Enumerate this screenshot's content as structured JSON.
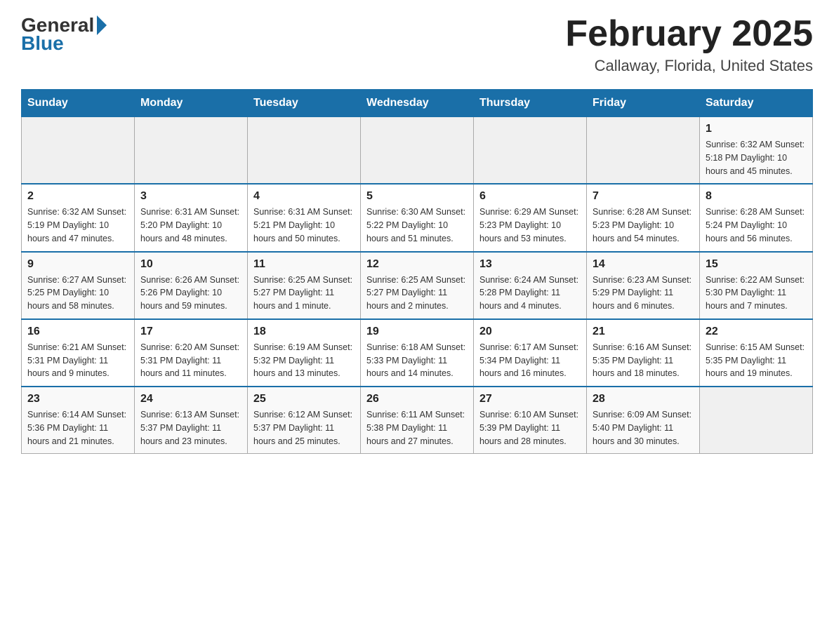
{
  "header": {
    "logo_general": "General",
    "logo_blue": "Blue",
    "title": "February 2025",
    "location": "Callaway, Florida, United States"
  },
  "weekdays": [
    "Sunday",
    "Monday",
    "Tuesday",
    "Wednesday",
    "Thursday",
    "Friday",
    "Saturday"
  ],
  "weeks": [
    [
      {
        "day": "",
        "info": ""
      },
      {
        "day": "",
        "info": ""
      },
      {
        "day": "",
        "info": ""
      },
      {
        "day": "",
        "info": ""
      },
      {
        "day": "",
        "info": ""
      },
      {
        "day": "",
        "info": ""
      },
      {
        "day": "1",
        "info": "Sunrise: 6:32 AM\nSunset: 5:18 PM\nDaylight: 10 hours\nand 45 minutes."
      }
    ],
    [
      {
        "day": "2",
        "info": "Sunrise: 6:32 AM\nSunset: 5:19 PM\nDaylight: 10 hours\nand 47 minutes."
      },
      {
        "day": "3",
        "info": "Sunrise: 6:31 AM\nSunset: 5:20 PM\nDaylight: 10 hours\nand 48 minutes."
      },
      {
        "day": "4",
        "info": "Sunrise: 6:31 AM\nSunset: 5:21 PM\nDaylight: 10 hours\nand 50 minutes."
      },
      {
        "day": "5",
        "info": "Sunrise: 6:30 AM\nSunset: 5:22 PM\nDaylight: 10 hours\nand 51 minutes."
      },
      {
        "day": "6",
        "info": "Sunrise: 6:29 AM\nSunset: 5:23 PM\nDaylight: 10 hours\nand 53 minutes."
      },
      {
        "day": "7",
        "info": "Sunrise: 6:28 AM\nSunset: 5:23 PM\nDaylight: 10 hours\nand 54 minutes."
      },
      {
        "day": "8",
        "info": "Sunrise: 6:28 AM\nSunset: 5:24 PM\nDaylight: 10 hours\nand 56 minutes."
      }
    ],
    [
      {
        "day": "9",
        "info": "Sunrise: 6:27 AM\nSunset: 5:25 PM\nDaylight: 10 hours\nand 58 minutes."
      },
      {
        "day": "10",
        "info": "Sunrise: 6:26 AM\nSunset: 5:26 PM\nDaylight: 10 hours\nand 59 minutes."
      },
      {
        "day": "11",
        "info": "Sunrise: 6:25 AM\nSunset: 5:27 PM\nDaylight: 11 hours\nand 1 minute."
      },
      {
        "day": "12",
        "info": "Sunrise: 6:25 AM\nSunset: 5:27 PM\nDaylight: 11 hours\nand 2 minutes."
      },
      {
        "day": "13",
        "info": "Sunrise: 6:24 AM\nSunset: 5:28 PM\nDaylight: 11 hours\nand 4 minutes."
      },
      {
        "day": "14",
        "info": "Sunrise: 6:23 AM\nSunset: 5:29 PM\nDaylight: 11 hours\nand 6 minutes."
      },
      {
        "day": "15",
        "info": "Sunrise: 6:22 AM\nSunset: 5:30 PM\nDaylight: 11 hours\nand 7 minutes."
      }
    ],
    [
      {
        "day": "16",
        "info": "Sunrise: 6:21 AM\nSunset: 5:31 PM\nDaylight: 11 hours\nand 9 minutes."
      },
      {
        "day": "17",
        "info": "Sunrise: 6:20 AM\nSunset: 5:31 PM\nDaylight: 11 hours\nand 11 minutes."
      },
      {
        "day": "18",
        "info": "Sunrise: 6:19 AM\nSunset: 5:32 PM\nDaylight: 11 hours\nand 13 minutes."
      },
      {
        "day": "19",
        "info": "Sunrise: 6:18 AM\nSunset: 5:33 PM\nDaylight: 11 hours\nand 14 minutes."
      },
      {
        "day": "20",
        "info": "Sunrise: 6:17 AM\nSunset: 5:34 PM\nDaylight: 11 hours\nand 16 minutes."
      },
      {
        "day": "21",
        "info": "Sunrise: 6:16 AM\nSunset: 5:35 PM\nDaylight: 11 hours\nand 18 minutes."
      },
      {
        "day": "22",
        "info": "Sunrise: 6:15 AM\nSunset: 5:35 PM\nDaylight: 11 hours\nand 19 minutes."
      }
    ],
    [
      {
        "day": "23",
        "info": "Sunrise: 6:14 AM\nSunset: 5:36 PM\nDaylight: 11 hours\nand 21 minutes."
      },
      {
        "day": "24",
        "info": "Sunrise: 6:13 AM\nSunset: 5:37 PM\nDaylight: 11 hours\nand 23 minutes."
      },
      {
        "day": "25",
        "info": "Sunrise: 6:12 AM\nSunset: 5:37 PM\nDaylight: 11 hours\nand 25 minutes."
      },
      {
        "day": "26",
        "info": "Sunrise: 6:11 AM\nSunset: 5:38 PM\nDaylight: 11 hours\nand 27 minutes."
      },
      {
        "day": "27",
        "info": "Sunrise: 6:10 AM\nSunset: 5:39 PM\nDaylight: 11 hours\nand 28 minutes."
      },
      {
        "day": "28",
        "info": "Sunrise: 6:09 AM\nSunset: 5:40 PM\nDaylight: 11 hours\nand 30 minutes."
      },
      {
        "day": "",
        "info": ""
      }
    ]
  ]
}
